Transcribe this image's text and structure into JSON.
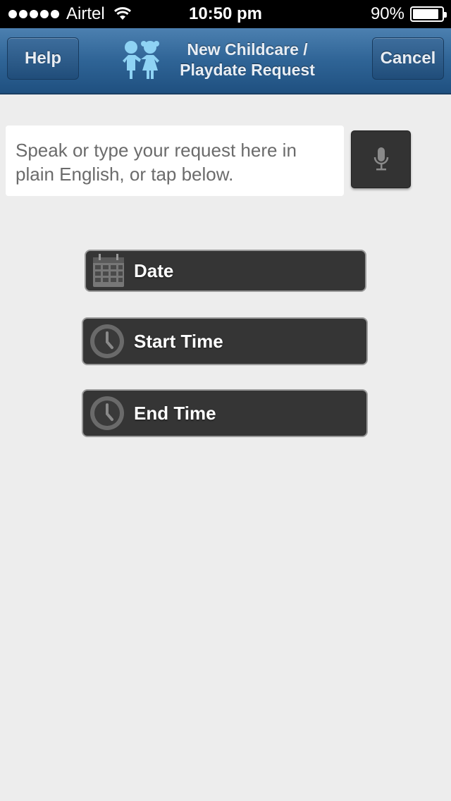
{
  "status_bar": {
    "carrier": "Airtel",
    "time": "10:50 pm",
    "battery": "90%",
    "battery_level": 0.9
  },
  "nav": {
    "help_label": "Help",
    "title_line1": "New Childcare /",
    "title_line2": "Playdate Request",
    "cancel_label": "Cancel"
  },
  "request": {
    "placeholder": "Speak or type your request here in plain English, or tap below."
  },
  "buttons": {
    "date_label": "Date",
    "start_time_label": "Start Time",
    "end_time_label": "End Time"
  },
  "icons": {
    "mic": "microphone-icon",
    "calendar": "calendar-icon",
    "clock": "clock-icon",
    "logo": "kids-logo-icon"
  },
  "colors": {
    "nav_bar": "#2f6496",
    "button_bg": "#353535",
    "page_bg": "#ededed"
  }
}
